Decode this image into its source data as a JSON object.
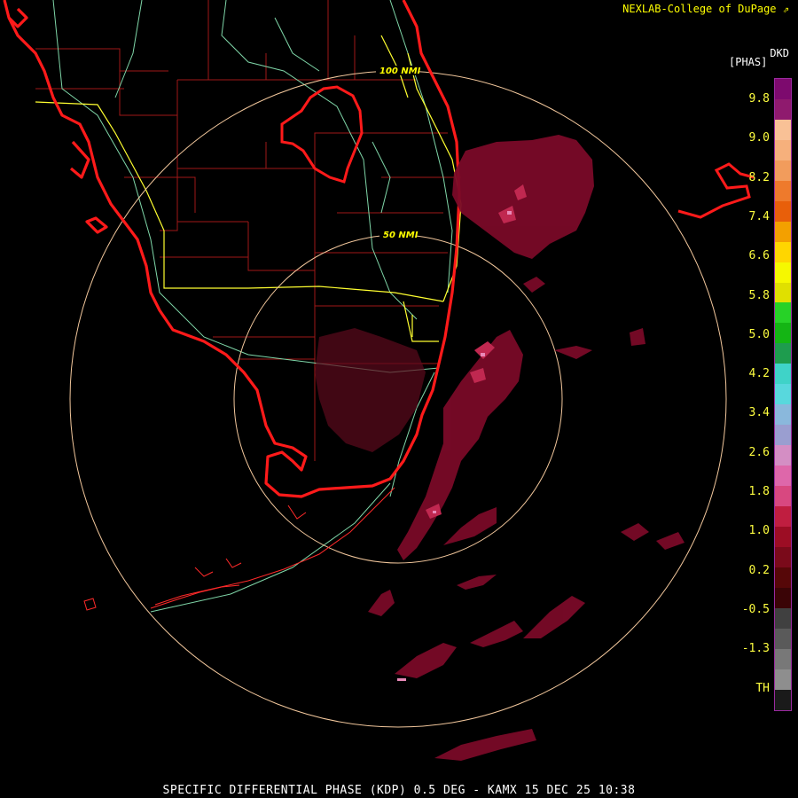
{
  "header": {
    "credit": "NEXLAB-College of DuPage",
    "credit_icon": "external-link-icon"
  },
  "product": {
    "code": "DKD",
    "units": "[PHAS]"
  },
  "colorbar": {
    "ticks": [
      "9.8",
      "9.0",
      "8.2",
      "7.4",
      "6.6",
      "5.8",
      "5.0",
      "4.2",
      "3.4",
      "2.6",
      "1.8",
      "1.0",
      "0.2",
      "-0.5",
      "-1.3",
      "TH"
    ],
    "colors": [
      "#7d0a6e",
      "#8f1a6e",
      "#f9c196",
      "#f6b07c",
      "#f29c5c",
      "#ee7a2c",
      "#e85f0a",
      "#f3a000",
      "#ffd600",
      "#f6f800",
      "#e0e000",
      "#27d227",
      "#14b514",
      "#1e9c4e",
      "#3fd3c8",
      "#58d8dd",
      "#8ab8dc",
      "#9a9ed0",
      "#d48ec4",
      "#de67aa",
      "#d84880",
      "#c01e40",
      "#9c0d24",
      "#7a0a1a",
      "#560708",
      "#3a0406",
      "#404040",
      "#5a5a5a",
      "#787878",
      "#8e8e8e",
      "#1a1a1a"
    ]
  },
  "map": {
    "range_rings": [
      "100 NMI",
      "50 NMI"
    ],
    "radar_site": "KAMX"
  },
  "footer": {
    "caption": "SPECIFIC DIFFERENTIAL PHASE (KDP) 0.5 DEG - KAMX 15 DEC 25 10:38"
  }
}
